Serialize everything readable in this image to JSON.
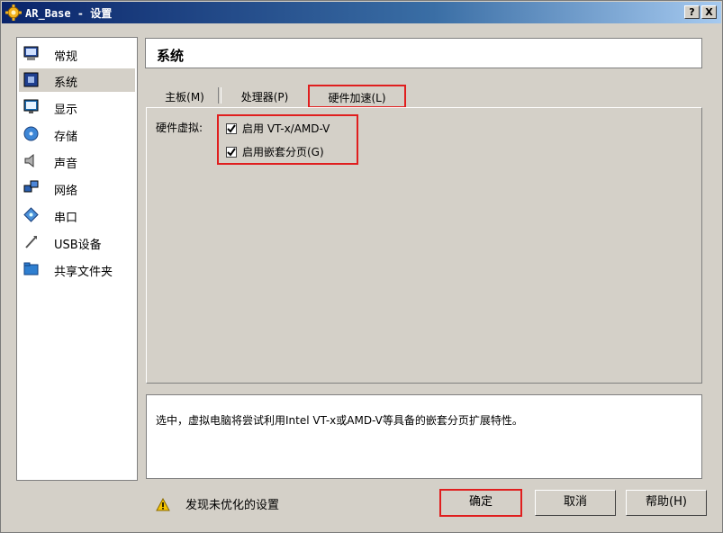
{
  "window": {
    "title": "AR_Base - 设置",
    "help_btn": "?",
    "close_btn": "X"
  },
  "sidebar": {
    "items": [
      {
        "label": "常规",
        "icon": "monitor-icon"
      },
      {
        "label": "系统",
        "icon": "chip-icon",
        "selected": true
      },
      {
        "label": "显示",
        "icon": "display-icon"
      },
      {
        "label": "存储",
        "icon": "disk-icon"
      },
      {
        "label": "声音",
        "icon": "speaker-icon"
      },
      {
        "label": "网络",
        "icon": "network-icon"
      },
      {
        "label": "串口",
        "icon": "serial-port-icon"
      },
      {
        "label": "USB设备",
        "icon": "usb-icon"
      },
      {
        "label": "共享文件夹",
        "icon": "folder-icon"
      }
    ]
  },
  "main": {
    "section_title": "系统",
    "tabs": [
      {
        "label": "主板(M)"
      },
      {
        "label": "处理器(P)"
      },
      {
        "label": "硬件加速(L)",
        "active": true
      }
    ],
    "hw_label": "硬件虚拟:",
    "checkboxes": [
      {
        "label": "启用 VT-x/AMD-V",
        "checked": true
      },
      {
        "label": "启用嵌套分页(G)",
        "checked": true
      }
    ],
    "description": "选中，虚拟电脑将尝试利用Intel VT-x或AMD-V等具备的嵌套分页扩展特性。"
  },
  "footer": {
    "warning": "发现未优化的设置",
    "ok": "确定",
    "cancel": "取消",
    "help": "帮助(H)"
  },
  "colors": {
    "highlight": "#e01e1e",
    "face": "#d4d0c8",
    "title_start": "#0a246a"
  }
}
